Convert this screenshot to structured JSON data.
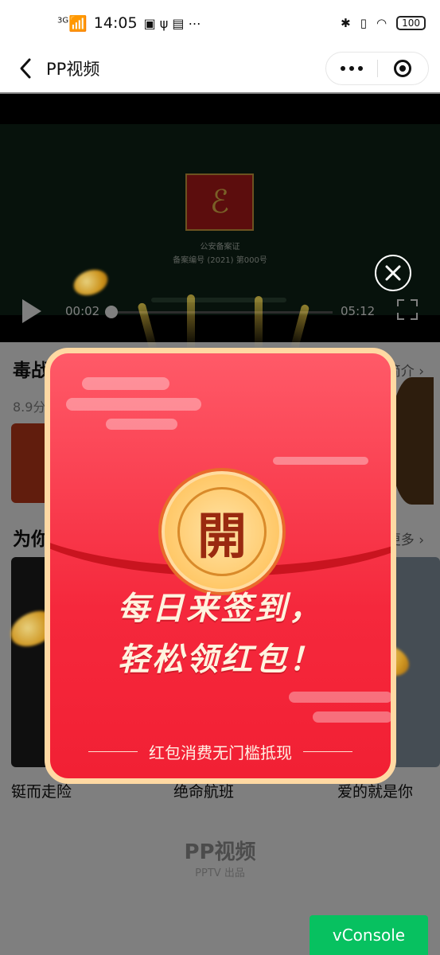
{
  "status_bar": {
    "network": "3G",
    "time": "14:05",
    "battery": "100"
  },
  "navbar": {
    "title": "PP视频"
  },
  "video": {
    "license_line1": "公安备案证",
    "license_line2": "备案编号 (2021) 第000号",
    "current_time": "00:02",
    "total_time": "05:12",
    "progress_fraction": 0.006
  },
  "sections": {
    "first_title": "毒战",
    "first_more": "简介 ›",
    "first_meta": "8.9分",
    "second_title": "为你",
    "second_more": "更多 ›"
  },
  "posters": [
    {
      "title": "铤而走险"
    },
    {
      "title": "绝命航班"
    },
    {
      "title": "爱的就是你"
    }
  ],
  "footer": {
    "logo": "PP视频",
    "sub": "PPTV 出品"
  },
  "redpacket": {
    "medal_char": "開",
    "slogan_line1": "每日来签到，",
    "slogan_line2": "轻松领红包！",
    "footer_text": "红包消费无门槛抵现",
    "color_primary": "#f5283c",
    "color_border": "#ffd9a3"
  },
  "vconsole": {
    "label": "vConsole",
    "color": "#07c160"
  }
}
